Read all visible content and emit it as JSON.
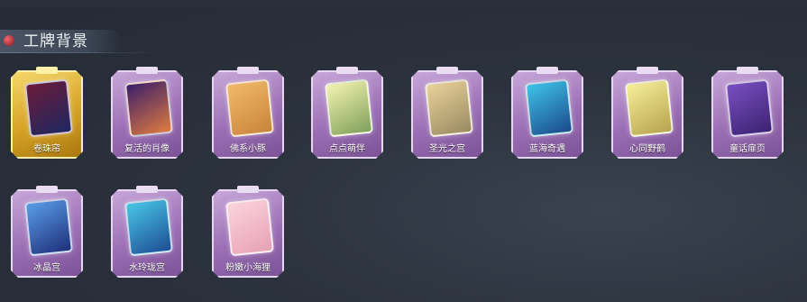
{
  "section": {
    "title": "工牌背景"
  },
  "cards": [
    {
      "label": "卷珠帘",
      "gold": true,
      "art": [
        "#6b1b3a",
        "#1d2860"
      ]
    },
    {
      "label": "复活的肖像",
      "gold": false,
      "art": [
        "#3a1f6a",
        "#e07b3f"
      ]
    },
    {
      "label": "佛系小豚",
      "gold": false,
      "art": [
        "#f2b96b",
        "#c8843b"
      ]
    },
    {
      "label": "点点萌伴",
      "gold": false,
      "art": [
        "#f4f2b0",
        "#7ea05a"
      ]
    },
    {
      "label": "圣光之宫",
      "gold": false,
      "art": [
        "#e8d29a",
        "#9a8a62"
      ]
    },
    {
      "label": "蓝海奇遇",
      "gold": false,
      "art": [
        "#3fc3e8",
        "#1b4a8a"
      ]
    },
    {
      "label": "心同野鹤",
      "gold": false,
      "art": [
        "#f6ee9a",
        "#b7a34d"
      ]
    },
    {
      "label": "童话扉页",
      "gold": false,
      "art": [
        "#7a4fc2",
        "#3a2270"
      ]
    },
    {
      "label": "冰晶宫",
      "gold": false,
      "art": [
        "#5a9de8",
        "#1f2f7a"
      ]
    },
    {
      "label": "水玲珑宫",
      "gold": false,
      "art": [
        "#48c6e6",
        "#1e4d95"
      ]
    },
    {
      "label": "粉嫩小海狸",
      "gold": false,
      "art": [
        "#fbd3dc",
        "#e7a1b6"
      ]
    }
  ]
}
